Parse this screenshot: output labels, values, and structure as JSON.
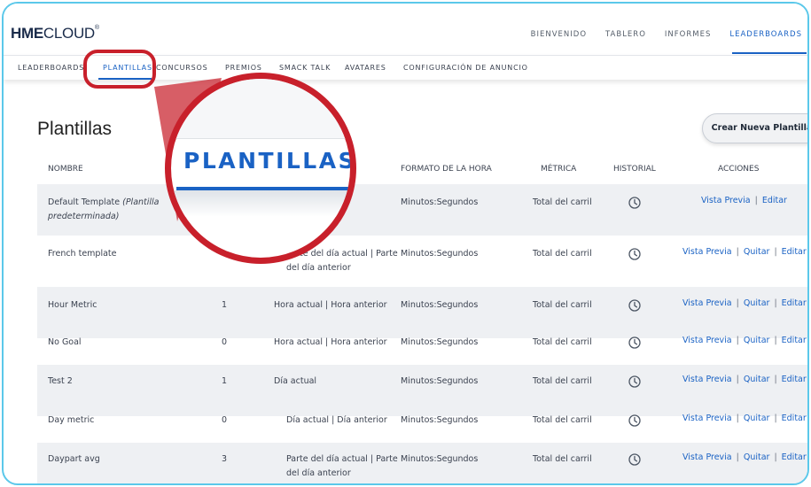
{
  "header": {
    "logo_bold": "HME",
    "logo_light": "CLOUD",
    "logo_mark": "®",
    "nav": [
      {
        "label": "BIENVENIDO",
        "active": false
      },
      {
        "label": "TABLERO",
        "active": false
      },
      {
        "label": "INFORMES",
        "active": false
      },
      {
        "label": "LEADERBOARDS",
        "active": true
      }
    ]
  },
  "subnav": [
    {
      "label": "LEADERBOARDS",
      "active": false
    },
    {
      "label": "PLANTILLAS",
      "active": true
    },
    {
      "label": "CONCURSOS",
      "active": false
    },
    {
      "label": "PREMIOS",
      "active": false
    },
    {
      "label": "SMACK TALK",
      "active": false
    },
    {
      "label": "AVATARES",
      "active": false
    },
    {
      "label": "CONFIGURACIÓN DE ANUNCIO",
      "active": false
    }
  ],
  "page": {
    "title": "Plantillas",
    "create_button": "Crear Nueva Plantilla"
  },
  "table": {
    "columns": {
      "name": "NOMBRE",
      "time_format": "FORMATO DE LA HORA",
      "metric": "MÉTRICA",
      "history": "HISTORIAL",
      "actions": "ACCIONES"
    },
    "actions": {
      "preview": "Vista Previa",
      "remove": "Quitar",
      "edit": "Editar"
    },
    "rows": [
      {
        "name": "Default Template",
        "name_note": "(Plantilla",
        "name_note2": "predeterminada)",
        "count": "",
        "period": "",
        "period2": "",
        "time_format": "Minutos:Segundos",
        "metric": "Total del carril"
      },
      {
        "name": "French template",
        "count": "1",
        "period": "Parte del día actual | Parte",
        "period2": "del día anterior",
        "time_format": "Minutos:Segundos",
        "metric": "Total del carril"
      },
      {
        "name": "Hour Metric",
        "count": "1",
        "period": "Hora actual | Hora anterior",
        "period2": "",
        "time_format": "Minutos:Segundos",
        "metric": "Total del carril"
      },
      {
        "name": "No Goal",
        "count": "0",
        "period": "Hora actual | Hora anterior",
        "period2": "",
        "time_format": "Minutos:Segundos",
        "metric": "Total del carril"
      },
      {
        "name": "Test 2",
        "count": "1",
        "period": "Día actual",
        "period2": "",
        "time_format": "Minutos:Segundos",
        "metric": "Total del carril"
      },
      {
        "name": "Day metric",
        "count": "0",
        "period": "Día actual | Día anterior",
        "period2": "",
        "time_format": "Minutos:Segundos",
        "metric": "Total del carril"
      },
      {
        "name": "Daypart avg",
        "count": "3",
        "period": "Parte del día actual | Parte",
        "period2": "del día anterior",
        "time_format": "Minutos:Segundos",
        "metric": "Total del carril"
      }
    ]
  },
  "magnifier": {
    "text": "PLANTILLAS",
    "color": "#c8202b"
  }
}
